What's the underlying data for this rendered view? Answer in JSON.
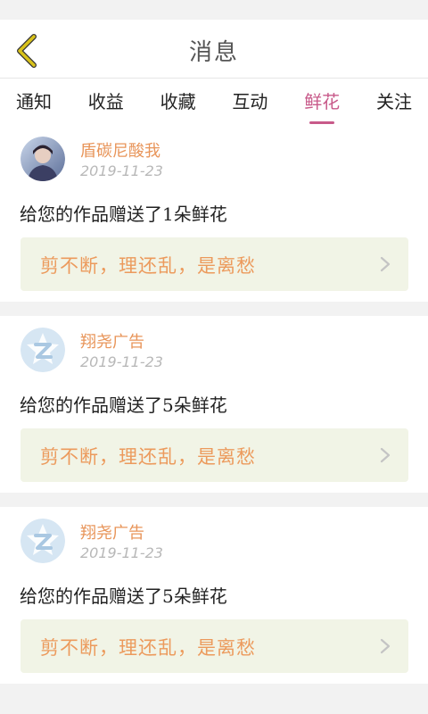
{
  "header": {
    "title": "消息"
  },
  "tabs": [
    {
      "label": "通知"
    },
    {
      "label": "收益"
    },
    {
      "label": "收藏"
    },
    {
      "label": "互动"
    },
    {
      "label": "鲜花",
      "active": true
    },
    {
      "label": "关注"
    }
  ],
  "messages": [
    {
      "username": "盾碳尼酸我",
      "date": "2019-11-23",
      "text": "给您的作品赠送了1朵鲜花",
      "quote": "剪不断，理还乱，是离愁",
      "avatar": "user-photo"
    },
    {
      "username": "翔尧广告",
      "date": "2019-11-23",
      "text": "给您的作品赠送了5朵鲜花",
      "quote": "剪不断，理还乱，是离愁",
      "avatar": "default-z-logo"
    },
    {
      "username": "翔尧广告",
      "date": "2019-11-23",
      "text": "给您的作品赠送了5朵鲜花",
      "quote": "剪不断，理还乱，是离愁",
      "avatar": "default-z-logo"
    }
  ],
  "colors": {
    "accent": "#c85a8a",
    "username": "#e8955a",
    "quote_text": "#ec9a5c",
    "quote_bg": "#f1f4e6",
    "back_arrow": "#d9c21a"
  }
}
